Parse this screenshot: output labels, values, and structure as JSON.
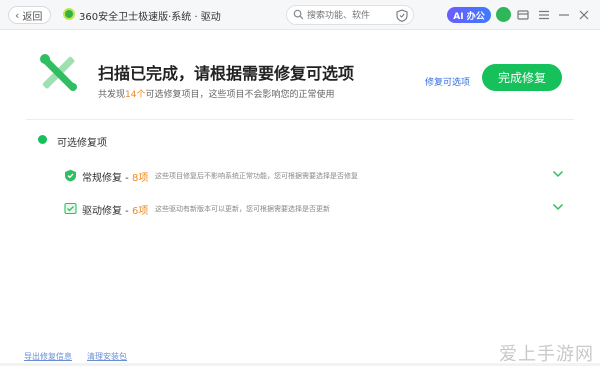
{
  "titlebar": {
    "back_label": "返回",
    "app_title": "360安全卫士极速版·系统 · 驱动",
    "search_placeholder": "搜索功能、软件",
    "ai_label": "AI 办公"
  },
  "hero": {
    "title": "扫描已完成，请根据需要修复可选项",
    "sub_prefix": "共发现",
    "sub_count": "14个",
    "sub_suffix": "可选修复项目，这些项目不会影响您的正常使用",
    "link_label": "修复可选项",
    "complete_label": "完成修复"
  },
  "section": {
    "title": "可选修复项",
    "items": [
      {
        "name": "常规修复 - ",
        "count": "8项",
        "desc": "这些项目修复后不影响系统正常功能，您可根据需要选择是否修复",
        "icon": "shield-check-icon"
      },
      {
        "name": "驱动修复 - ",
        "count": "6项",
        "desc": "这些驱动有新版本可以更新，您可根据需要选择是否更新",
        "icon": "driver-icon"
      }
    ]
  },
  "footer": {
    "link1": "导出修复信息",
    "link2": "清理安装包"
  },
  "watermark": "爱上手游网",
  "colors": {
    "accent": "#16c15b",
    "link": "#2f6fe0",
    "count": "#f08a1c"
  }
}
